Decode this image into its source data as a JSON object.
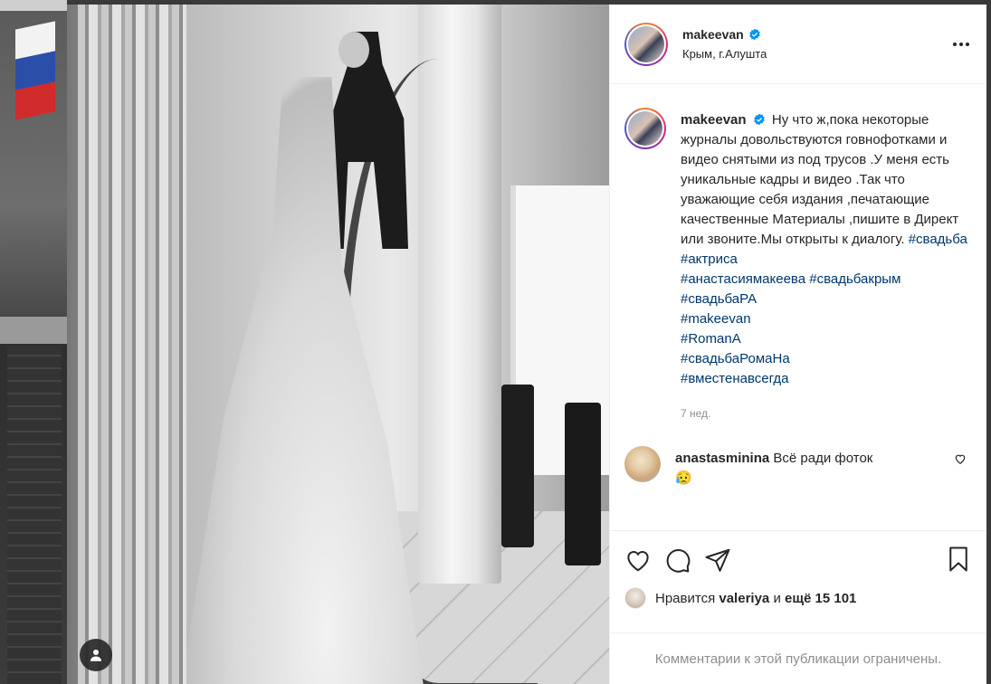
{
  "post": {
    "username": "makeevan",
    "location": "Крым, г.Алушта",
    "caption_text": "Ну что ж,пока некоторые журналы довольствуются говнофотками и видео снятыми из под трусов .У меня есть уникальные кадры и видео .Так что уважающие себя издания ,печатающие качественные Материалы ,пишите в Директ или звоните.Мы открыты к диалогу.",
    "hashtags": [
      "#свадьба",
      "#актриса",
      "#анастасиямакеева",
      "#свадьбакрым",
      "#свадьбаРА",
      "#makeevan",
      "#RomanA",
      "#свадьбаРомаНа",
      "#вместенавсегда"
    ],
    "time_ago": "7 нед."
  },
  "comment": {
    "username": "anastasminina",
    "text": "Всё ради фоток",
    "emoji": "😥"
  },
  "likes": {
    "prefix": "Нравится",
    "user": "valeriya",
    "and": "и",
    "others": "ещё 15 101"
  },
  "footer": {
    "notice": "Комментарии к этой публикации ограничены."
  },
  "colors": {
    "verified": "#0095f6",
    "hashtag": "#00376b",
    "text": "#262626",
    "muted": "#8e8e8e"
  },
  "icons": [
    "user-tag-icon",
    "more-options-icon",
    "verified-badge-icon",
    "like-heart-icon",
    "comment-icon",
    "share-icon",
    "bookmark-icon",
    "comment-like-icon"
  ]
}
